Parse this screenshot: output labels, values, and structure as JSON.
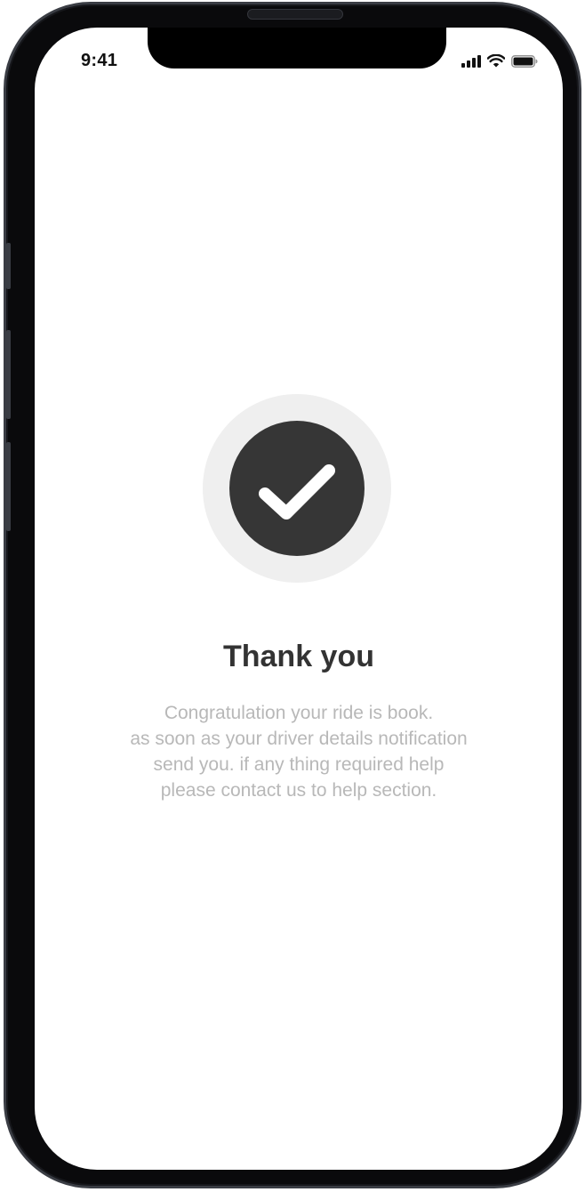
{
  "status_bar": {
    "time": "9:41",
    "icons": [
      "cellular-signal-icon",
      "wifi-icon",
      "battery-icon"
    ]
  },
  "confirmation": {
    "icon": "checkmark-icon",
    "title": "Thank you",
    "message_lines": [
      "Congratulation your ride is book.",
      "as soon as your driver details notification",
      "send you. if any thing required help",
      "please contact us to help section."
    ]
  },
  "colors": {
    "icon_circle": "#363636",
    "icon_ring": "#efefef",
    "title": "#333333",
    "message": "#b8b8b8"
  }
}
